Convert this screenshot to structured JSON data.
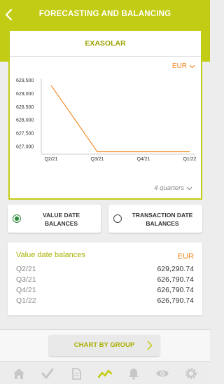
{
  "header": {
    "title": "FORECASTING AND BALANCING"
  },
  "chart_card": {
    "title": "EXASOLAR",
    "currency": "EUR",
    "period_select": "4 quarters"
  },
  "chart_data": {
    "type": "line",
    "categories": [
      "Q2/21",
      "Q3/21",
      "Q4/21",
      "Q1/22"
    ],
    "values": [
      629290.74,
      626790.74,
      626790.74,
      626790.74
    ],
    "ylim": [
      626700,
      629550
    ],
    "yticks": [
      "629,500",
      "629,000",
      "628,500",
      "628,000",
      "627,500",
      "627,000"
    ],
    "ytick_values": [
      629500,
      629000,
      628500,
      628000,
      627500,
      627000
    ],
    "line_color": "#f0861e"
  },
  "toggles": {
    "value_date": "VALUE DATE BALANCES",
    "transaction_date": "TRANSACTION DATE BALANCES",
    "selected": "value_date"
  },
  "balances": {
    "title": "Value date balances",
    "currency": "EUR",
    "rows": [
      {
        "quarter": "Q2/21",
        "value": "629,290.74"
      },
      {
        "quarter": "Q3/21",
        "value": "626,790.74"
      },
      {
        "quarter": "Q4/21",
        "value": "626,790.74"
      },
      {
        "quarter": "Q1/22",
        "value": "626,790.74"
      }
    ]
  },
  "footer": {
    "chart_by_group": "CHART BY GROUP"
  },
  "tabbar": {
    "icons": [
      "home-icon",
      "check-icon",
      "document-icon",
      "trend-icon",
      "bell-icon",
      "eye-icon",
      "gear-icon"
    ],
    "active": "trend-icon"
  },
  "colors": {
    "accent": "#c3cc14",
    "orange": "#f0861e",
    "green": "#2d8a3c"
  }
}
